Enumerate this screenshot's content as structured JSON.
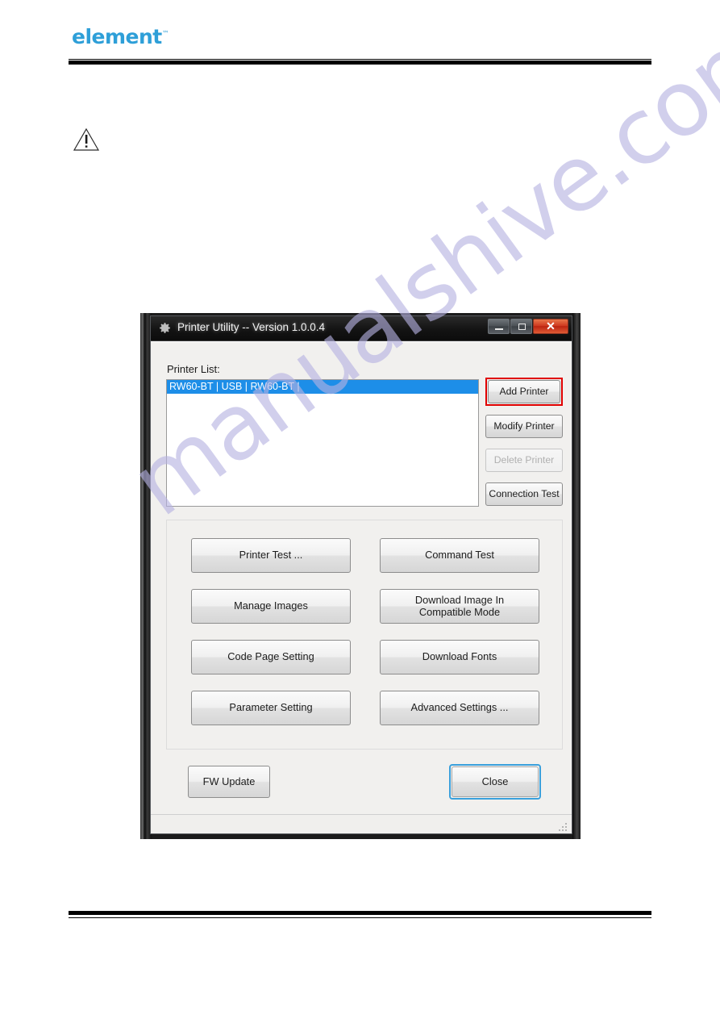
{
  "page": {
    "logo_text": "element",
    "logo_tm": "™"
  },
  "warning": {
    "icon": "warning-triangle-icon"
  },
  "watermark": {
    "text": "manualshive.com",
    "color": "#b6b2e2"
  },
  "window": {
    "title": "Printer Utility -- Version 1.0.0.4",
    "app_icon": "gear-icon",
    "controls": {
      "minimize": "minimize-icon",
      "maximize": "maximize-icon",
      "close": "✕"
    }
  },
  "printer_list": {
    "label": "Printer List:",
    "items": [
      {
        "text": "RW60-BT  |  USB  |  RW60-BT  |",
        "selected": true
      }
    ],
    "selection_color": "#1d8ee8"
  },
  "side_buttons": [
    {
      "label": "Add Printer",
      "enabled": true,
      "highlighted": true,
      "highlight_color": "#e00000"
    },
    {
      "label": "Modify Printer",
      "enabled": true,
      "highlighted": false
    },
    {
      "label": "Delete Printer",
      "enabled": false,
      "highlighted": false
    },
    {
      "label": "Connection Test",
      "enabled": true,
      "highlighted": false
    }
  ],
  "action_grid": [
    {
      "label": "Printer Test ..."
    },
    {
      "label": "Command Test"
    },
    {
      "label": "Manage Images"
    },
    {
      "label": "Download Image In\nCompatible Mode"
    },
    {
      "label": "Code Page Setting"
    },
    {
      "label": "Download Fonts"
    },
    {
      "label": "Parameter Setting"
    },
    {
      "label": "Advanced Settings ..."
    }
  ],
  "footer_buttons": {
    "fw_update": "FW Update",
    "close": "Close",
    "close_focus_color": "#3aa0dc"
  },
  "statusbar": {
    "grip": "resize-grip-icon"
  }
}
